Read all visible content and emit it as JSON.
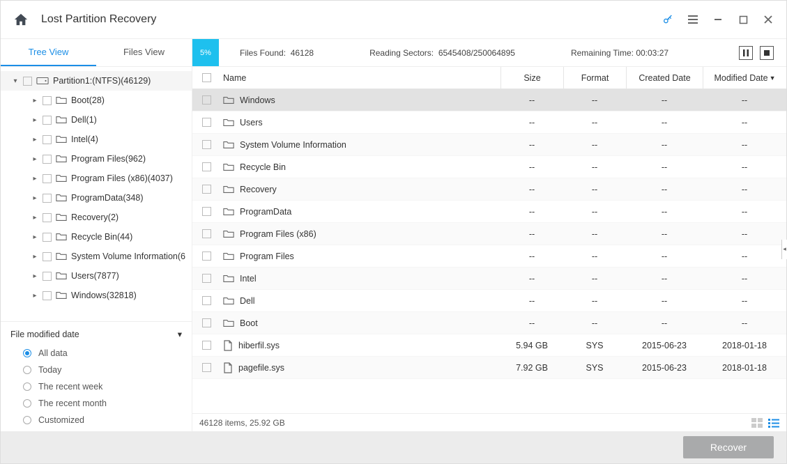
{
  "titlebar": {
    "title": "Lost Partition Recovery"
  },
  "viewtabs": {
    "tree": "Tree View",
    "files": "Files View"
  },
  "progress": {
    "pct": "5%"
  },
  "status": {
    "files_found_label": "Files Found:",
    "files_found": "46128",
    "reading_label": "Reading Sectors:",
    "reading": "6545408/250064895",
    "remaining_label": "Remaining Time:",
    "remaining": "00:03:27"
  },
  "tree": {
    "root": "Partition1:(NTFS)(46129)",
    "items": [
      "Boot(28)",
      "Dell(1)",
      "Intel(4)",
      "Program Files(962)",
      "Program Files (x86)(4037)",
      "ProgramData(348)",
      "Recovery(2)",
      "Recycle Bin(44)",
      "System Volume Information(6",
      "Users(7877)",
      "Windows(32818)"
    ]
  },
  "filter": {
    "header": "File modified date",
    "options": [
      "All data",
      "Today",
      "The recent week",
      "The recent month",
      "Customized"
    ],
    "selected": 0
  },
  "columns": {
    "name": "Name",
    "size": "Size",
    "format": "Format",
    "created": "Created Date",
    "modified": "Modified Date"
  },
  "rows": [
    {
      "name": "Windows",
      "type": "folder",
      "size": "--",
      "fmt": "--",
      "cd": "--",
      "md": "--",
      "sel": true
    },
    {
      "name": "Users",
      "type": "folder",
      "size": "--",
      "fmt": "--",
      "cd": "--",
      "md": "--"
    },
    {
      "name": "System Volume Information",
      "type": "folder",
      "size": "--",
      "fmt": "--",
      "cd": "--",
      "md": "--"
    },
    {
      "name": "Recycle Bin",
      "type": "folder",
      "size": "--",
      "fmt": "--",
      "cd": "--",
      "md": "--"
    },
    {
      "name": "Recovery",
      "type": "folder",
      "size": "--",
      "fmt": "--",
      "cd": "--",
      "md": "--"
    },
    {
      "name": "ProgramData",
      "type": "folder",
      "size": "--",
      "fmt": "--",
      "cd": "--",
      "md": "--"
    },
    {
      "name": "Program Files (x86)",
      "type": "folder",
      "size": "--",
      "fmt": "--",
      "cd": "--",
      "md": "--"
    },
    {
      "name": "Program Files",
      "type": "folder",
      "size": "--",
      "fmt": "--",
      "cd": "--",
      "md": "--"
    },
    {
      "name": "Intel",
      "type": "folder",
      "size": "--",
      "fmt": "--",
      "cd": "--",
      "md": "--"
    },
    {
      "name": "Dell",
      "type": "folder",
      "size": "--",
      "fmt": "--",
      "cd": "--",
      "md": "--"
    },
    {
      "name": "Boot",
      "type": "folder",
      "size": "--",
      "fmt": "--",
      "cd": "--",
      "md": "--"
    },
    {
      "name": "hiberfil.sys",
      "type": "file",
      "size": "5.94 GB",
      "fmt": "SYS",
      "cd": "2015-06-23",
      "md": "2018-01-18"
    },
    {
      "name": "pagefile.sys",
      "type": "file",
      "size": "7.92 GB",
      "fmt": "SYS",
      "cd": "2015-06-23",
      "md": "2018-01-18"
    }
  ],
  "listfoot": {
    "summary": "46128 items, 25.92 GB"
  },
  "footer": {
    "recover": "Recover"
  }
}
